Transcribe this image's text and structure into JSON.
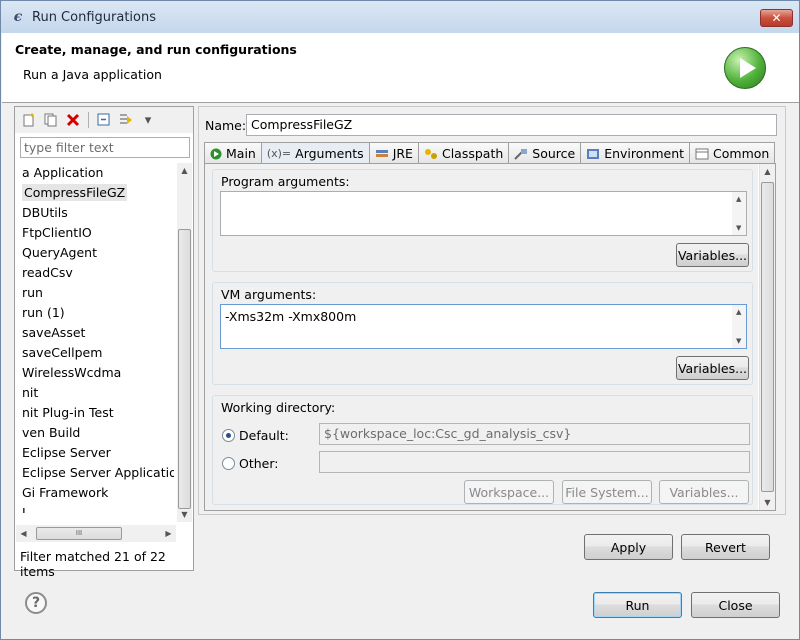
{
  "window": {
    "title": "Run Configurations",
    "close_glyph": "✕"
  },
  "banner": {
    "title": "Create, manage, and run configurations",
    "subtitle": "Run a Java application"
  },
  "left": {
    "filter_placeholder": "type filter text",
    "items": [
      "a Application",
      "CompressFileGZ",
      "DBUtils",
      "FtpClientIO",
      "QueryAgent",
      "readCsv",
      "run",
      "run (1)",
      "saveAsset",
      "saveCellpem",
      "WirelessWcdma",
      "nit",
      "nit Plug-in Test",
      "ven Build",
      "Eclipse Server",
      "Eclipse Server Application",
      "Gi Framework",
      "L"
    ],
    "status": "Filter matched 21 of 22 items",
    "scroll_grip": "III"
  },
  "config": {
    "name_label": "Name:",
    "name_value": "CompressFileGZ",
    "tabs": [
      {
        "label": "Main",
        "icon": "main-icon"
      },
      {
        "label": "Arguments",
        "icon": "arguments-icon"
      },
      {
        "label": "JRE",
        "icon": "jre-icon"
      },
      {
        "label": "Classpath",
        "icon": "classpath-icon"
      },
      {
        "label": "Source",
        "icon": "source-icon"
      },
      {
        "label": "Environment",
        "icon": "environment-icon"
      },
      {
        "label": "Common",
        "icon": "common-icon"
      }
    ],
    "program_args": {
      "title": "Program arguments:",
      "value": "",
      "variables_label": "Variables..."
    },
    "vm_args": {
      "title": "VM arguments:",
      "value": "-Xms32m -Xmx800m",
      "variables_label": "Variables..."
    },
    "working_dir": {
      "title": "Working directory:",
      "default_label": "Default:",
      "default_value": "${workspace_loc:Csc_gd_analysis_csv}",
      "other_label": "Other:",
      "other_value": "",
      "workspace_label": "Workspace...",
      "filesystem_label": "File System...",
      "variables_label": "Variables..."
    },
    "apply_label": "Apply",
    "revert_label": "Revert"
  },
  "footer": {
    "help_glyph": "?",
    "run_label": "Run",
    "close_label": "Close"
  }
}
